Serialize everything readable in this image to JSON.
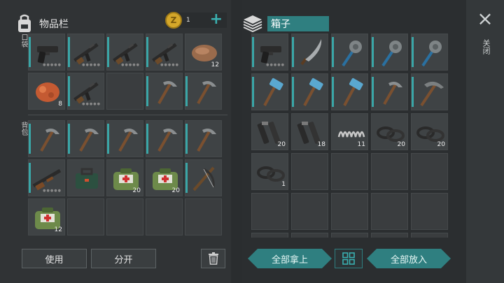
{
  "inventory": {
    "title": "物品栏",
    "coins": "1",
    "add": "+",
    "pockets_label": "口袋",
    "backpack_label": "背包"
  },
  "crate": {
    "title": "箱子"
  },
  "close": {
    "icon": "×",
    "label": "关闭"
  },
  "buttons": {
    "use": "使用",
    "split": "分开",
    "take_all": "全部拿上",
    "put_all": "全部放入"
  },
  "colors": {
    "accent": "#2f7f80",
    "bar": "#3aa6a7",
    "coin": "#d4a72a"
  },
  "pockets": [
    {
      "icon": "pistol",
      "bar": true,
      "dots": true
    },
    {
      "icon": "rifle",
      "bar": true,
      "dots": true
    },
    {
      "icon": "rifle",
      "bar": true,
      "dots": true
    },
    {
      "icon": "rifle",
      "bar": true,
      "dots": true
    },
    {
      "icon": "stone",
      "count": "12"
    },
    {
      "icon": "ore",
      "count": "8"
    },
    {
      "icon": "rifle",
      "bar": true,
      "dots": true
    },
    {
      "icon": "empty"
    },
    {
      "icon": "pickaxe",
      "bar": true
    },
    {
      "icon": "pickaxe",
      "bar": true
    }
  ],
  "backpack": [
    {
      "icon": "pickaxe",
      "bar": true
    },
    {
      "icon": "pickaxe",
      "bar": true
    },
    {
      "icon": "pickaxe",
      "bar": true
    },
    {
      "icon": "pickaxe",
      "bar": true
    },
    {
      "icon": "pickaxe",
      "bar": true
    },
    {
      "icon": "shotgun",
      "bar": true,
      "dots": true
    },
    {
      "icon": "toolkit"
    },
    {
      "icon": "medkit",
      "count": "20"
    },
    {
      "icon": "medkit",
      "count": "20"
    },
    {
      "icon": "crossbow",
      "bar": true
    },
    {
      "icon": "medkit",
      "count": "12"
    },
    {
      "icon": "empty"
    },
    {
      "icon": "empty"
    },
    {
      "icon": "empty"
    },
    {
      "icon": "empty"
    }
  ],
  "crate_items": [
    {
      "icon": "pistol",
      "bar": true,
      "dots": true
    },
    {
      "icon": "machete",
      "bar": true
    },
    {
      "icon": "mace",
      "bar": true
    },
    {
      "icon": "mace",
      "bar": true
    },
    {
      "icon": "mace",
      "bar": true
    },
    {
      "icon": "hammer",
      "bar": true
    },
    {
      "icon": "hammer",
      "bar": true
    },
    {
      "icon": "hammer",
      "bar": true
    },
    {
      "icon": "pickaxe",
      "bar": true
    },
    {
      "icon": "pickaxe2",
      "bar": true
    },
    {
      "icon": "pipes",
      "count": "20"
    },
    {
      "icon": "pipes",
      "count": "18"
    },
    {
      "icon": "spring",
      "count": "11"
    },
    {
      "icon": "rings",
      "count": "20"
    },
    {
      "icon": "rings",
      "count": "20"
    },
    {
      "icon": "rings",
      "count": "1"
    },
    {
      "icon": "empty"
    },
    {
      "icon": "empty"
    },
    {
      "icon": "empty"
    },
    {
      "icon": "empty"
    },
    {
      "icon": "empty"
    },
    {
      "icon": "empty"
    },
    {
      "icon": "empty"
    },
    {
      "icon": "empty"
    },
    {
      "icon": "empty"
    },
    {
      "icon": "empty"
    },
    {
      "icon": "empty"
    },
    {
      "icon": "empty"
    },
    {
      "icon": "empty"
    },
    {
      "icon": "empty"
    }
  ]
}
